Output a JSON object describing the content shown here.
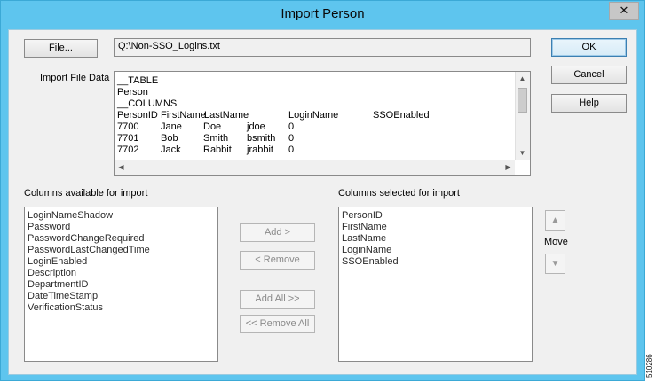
{
  "window": {
    "title": "Import  Person",
    "close_glyph": "✕"
  },
  "file": {
    "button_label": "File...",
    "path": "Q:\\Non-SSO_Logins.txt"
  },
  "buttons": {
    "ok": "OK",
    "cancel": "Cancel",
    "help": "Help"
  },
  "import_data": {
    "label": "Import File Data",
    "lines": [
      "__TABLE",
      "Person",
      "__COLUMNS"
    ],
    "headers": [
      "PersonID",
      "FirstName",
      "LastName",
      "LoginName",
      "SSOEnabled"
    ],
    "rows": [
      [
        "7700",
        "Jane",
        "Doe",
        "jdoe",
        "0"
      ],
      [
        "7701",
        "Bob",
        "Smith",
        "bsmith",
        "0"
      ],
      [
        "7702",
        "Jack",
        "Rabbit",
        "jrabbit",
        "0"
      ]
    ]
  },
  "available": {
    "label": "Columns available for import",
    "items": [
      "LoginNameShadow",
      "Password",
      "PasswordChangeRequired",
      "PasswordLastChangedTime",
      "LoginEnabled",
      "Description",
      "DepartmentID",
      "DateTimeStamp",
      "VerificationStatus"
    ]
  },
  "selected": {
    "label": "Columns selected for import",
    "items": [
      "PersonID",
      "FirstName",
      "LastName",
      "LoginName",
      "SSOEnabled"
    ]
  },
  "transfer": {
    "add": "Add >",
    "remove": "< Remove",
    "add_all": "Add All >>",
    "remove_all": "<< Remove All"
  },
  "move": {
    "label": "Move",
    "up_icon": "arrow-up-icon",
    "down_icon": "arrow-down-icon"
  },
  "figure_id": "510286"
}
